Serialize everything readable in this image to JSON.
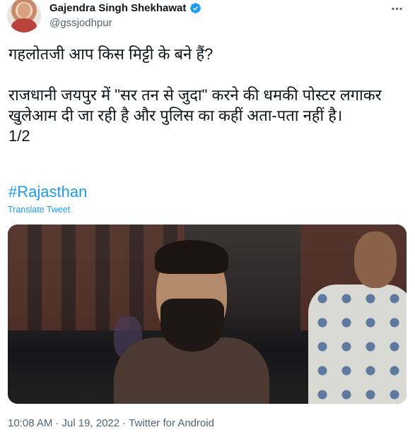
{
  "author": {
    "display_name": "Gajendra Singh Shekhawat",
    "handle": "@gssjodhpur"
  },
  "tweet": {
    "text": "गहलोतजी आप किस मिट्टी के बने हैं?\n\nराजधानी जयपुर में \"सर तन से जुदा\" करने की धमकी पोस्टर लगाकर खुलेआम दी जा रही है और पुलिस का कहीं अता-पता नहीं है।\n1/2",
    "hashtag": "#Rajasthan",
    "translate_label": "Translate Tweet"
  },
  "meta": {
    "time": "10:08 AM",
    "separator": "·",
    "date": "Jul 19, 2022",
    "source": "Twitter for Android"
  },
  "icons": {
    "verified": "verified-badge-icon",
    "more": "more-options-icon"
  },
  "colors": {
    "link": "#1d9bf0",
    "secondary_text": "#536471",
    "text": "#0f1419"
  }
}
